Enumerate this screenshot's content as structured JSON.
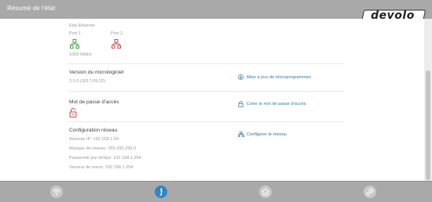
{
  "header": {
    "title": "Résumé de l'état",
    "logo_text": "devolo"
  },
  "ethernet": {
    "label": "Etat Ethernet",
    "ports": [
      {
        "label": "Port 1",
        "status_color": "#3fa33f"
      },
      {
        "label": "Port 2",
        "status_color": "#d64545"
      }
    ],
    "speed": "1000 Mbit/s"
  },
  "firmware": {
    "title": "Version du micrologiciel",
    "version": "2.0.0 (2017-09-22)",
    "link_label": "Mise à jour de microprogrammes",
    "link_icon": "download-icon"
  },
  "password": {
    "title": "Mot de passe d'accès",
    "status_icon": "unlocked-padlock-icon",
    "status_color": "#d64545",
    "link_label": "Créer le mot de passe d'accès",
    "link_icon": "lock-icon"
  },
  "network": {
    "title": "Configuration réseau",
    "ip": "Adresse IP: 192.168.1.54",
    "mask": "Masque de réseau: 255.255.255.0",
    "gateway": "Passerelle par défaut: 192.168.1.254",
    "dns": "Serveur de noms: 192.168.1.254",
    "link_label": "Configurer le réseau",
    "link_icon": "network-icon"
  },
  "footer": {
    "items": [
      {
        "icon": "wifi-icon",
        "active": false
      },
      {
        "icon": "info-icon",
        "active": true
      },
      {
        "icon": "home-network-icon",
        "active": false
      },
      {
        "icon": "settings-icon",
        "active": false
      }
    ]
  },
  "colors": {
    "accent": "#2f86c6",
    "link": "#2f79a8",
    "header_bg": "#a9a9a9",
    "ok": "#3fa33f",
    "error": "#d64545"
  }
}
